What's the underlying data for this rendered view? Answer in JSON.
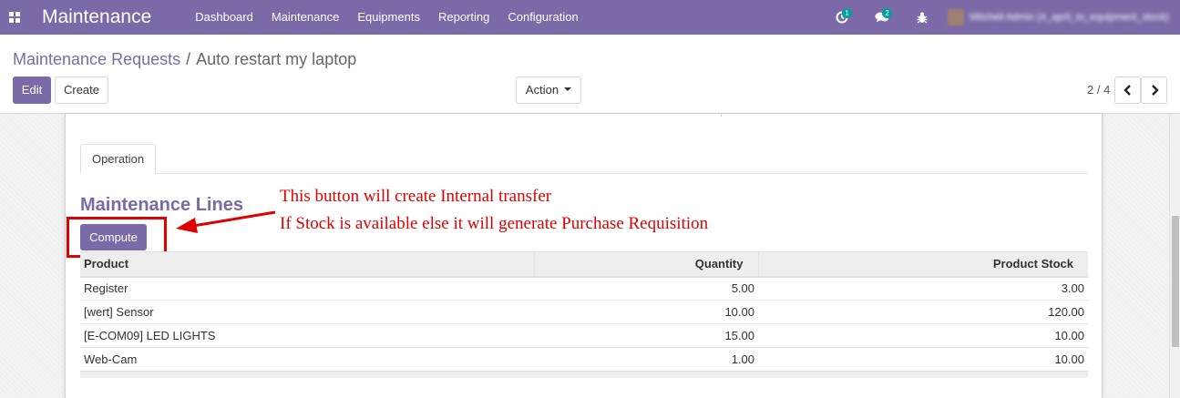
{
  "navbar": {
    "app_name": "Maintenance",
    "menu": [
      "Dashboard",
      "Maintenance",
      "Equipments",
      "Reporting",
      "Configuration"
    ],
    "activity_badge": "1",
    "messages_badge": "2",
    "user_name": "Mitchell Admin (4_april_to_equipment_stock)"
  },
  "breadcrumb": {
    "parent": "Maintenance Requests",
    "separator": "/",
    "current": "Auto restart my laptop"
  },
  "toolbar": {
    "edit_label": "Edit",
    "create_label": "Create",
    "action_label": "Action",
    "pager": "2 / 4"
  },
  "form": {
    "tab_label": "Operation",
    "section_title": "Maintenance Lines",
    "compute_label": "Compute",
    "annotation_line1": "This button will create Internal transfer",
    "annotation_line2": "If Stock is available else it will generate Purchase Requisition"
  },
  "table": {
    "headers": [
      "Product",
      "Quantity",
      "Product Stock"
    ],
    "rows": [
      [
        "Register",
        "5.00",
        "3.00"
      ],
      [
        "[wert] Sensor",
        "10.00",
        "120.00"
      ],
      [
        "[E-COM09] LED LIGHTS",
        "15.00",
        "10.00"
      ],
      [
        "Web-Cam",
        "1.00",
        "10.00"
      ]
    ]
  },
  "colors": {
    "brand": "#7c6aa8",
    "annotation": "#e00000",
    "badge": "#00a09d"
  },
  "icons": [
    "apps-grid-icon",
    "activity-clock-icon",
    "chat-bubbles-icon",
    "bug-icon",
    "chevron-left-icon",
    "chevron-right-icon",
    "caret-down-icon",
    "arrow-left-icon"
  ]
}
